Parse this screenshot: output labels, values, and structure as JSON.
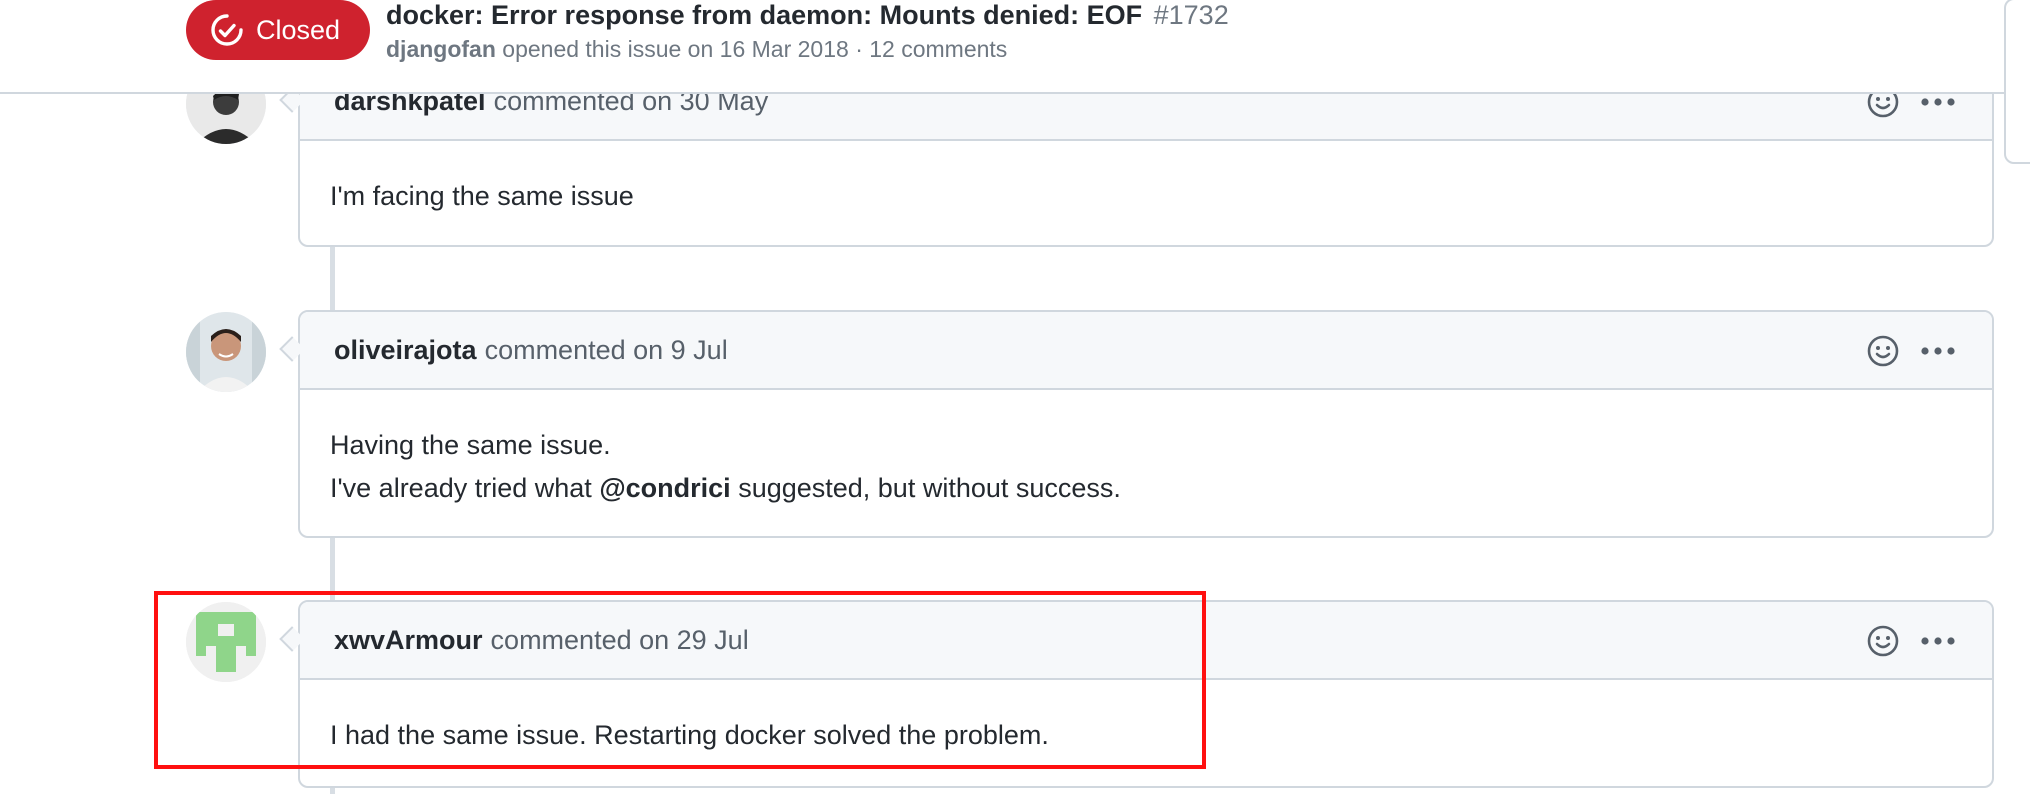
{
  "header": {
    "state_label": "Closed",
    "title": "docker: Error response from daemon: Mounts denied: EOF",
    "issue_number": "#1732",
    "author": "djangofan",
    "opened_text": "opened this issue on 16 Mar 2018 · 12 comments"
  },
  "comments": [
    {
      "username": "darshkpatel",
      "date_text": "commented on 30 May",
      "body_lines": [
        "I'm facing the same issue"
      ]
    },
    {
      "username": "oliveirajota",
      "date_text": "commented on 9 Jul",
      "body_line1": "Having the same issue.",
      "body_line2_pre": "I've already tried what",
      "mention": "@condrici",
      "body_line2_post": "suggested, but without success."
    },
    {
      "username": "xwvArmour",
      "date_text": "commented on 29 Jul",
      "body_lines": [
        "I had the same issue. Restarting docker solved the problem."
      ]
    }
  ],
  "icons": {
    "state": "issue-closed-icon",
    "reaction": "smiley-icon",
    "menu": "kebab-horizontal-icon"
  },
  "colors": {
    "closed_badge": "#cf222e",
    "highlight": "#ff1010",
    "identicon": "#8fd58a"
  }
}
